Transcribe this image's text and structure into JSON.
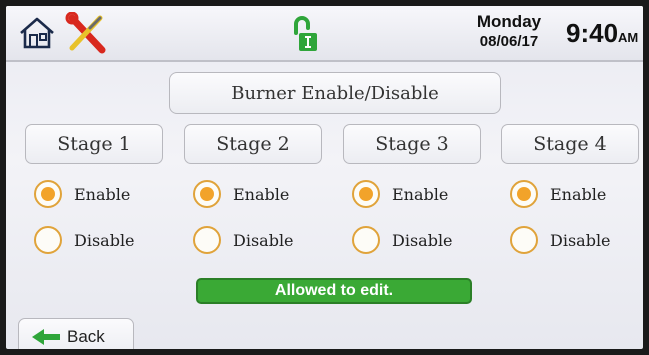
{
  "header": {
    "icons": [
      "home-icon",
      "tools-icon",
      "unlocked-padlock-icon"
    ],
    "day": "Monday",
    "date": "08/06/17",
    "time": "9:40",
    "ampm": "AM"
  },
  "screen_title": "Burner Enable/Disable",
  "stages": [
    {
      "label": "Stage 1",
      "enable_label": "Enable",
      "disable_label": "Disable",
      "selected": "Enable"
    },
    {
      "label": "Stage 2",
      "enable_label": "Enable",
      "disable_label": "Disable",
      "selected": "Enable"
    },
    {
      "label": "Stage 3",
      "enable_label": "Enable",
      "disable_label": "Disable",
      "selected": "Enable"
    },
    {
      "label": "Stage 4",
      "enable_label": "Enable",
      "disable_label": "Disable",
      "selected": "Enable"
    }
  ],
  "status": {
    "text": "Allowed to edit.",
    "color": "#3aa935"
  },
  "back_button": {
    "label": "Back",
    "icon": "arrow-left-icon"
  },
  "colors": {
    "radio_accent": "#f2a32a",
    "lock_green": "#2fa53a"
  }
}
